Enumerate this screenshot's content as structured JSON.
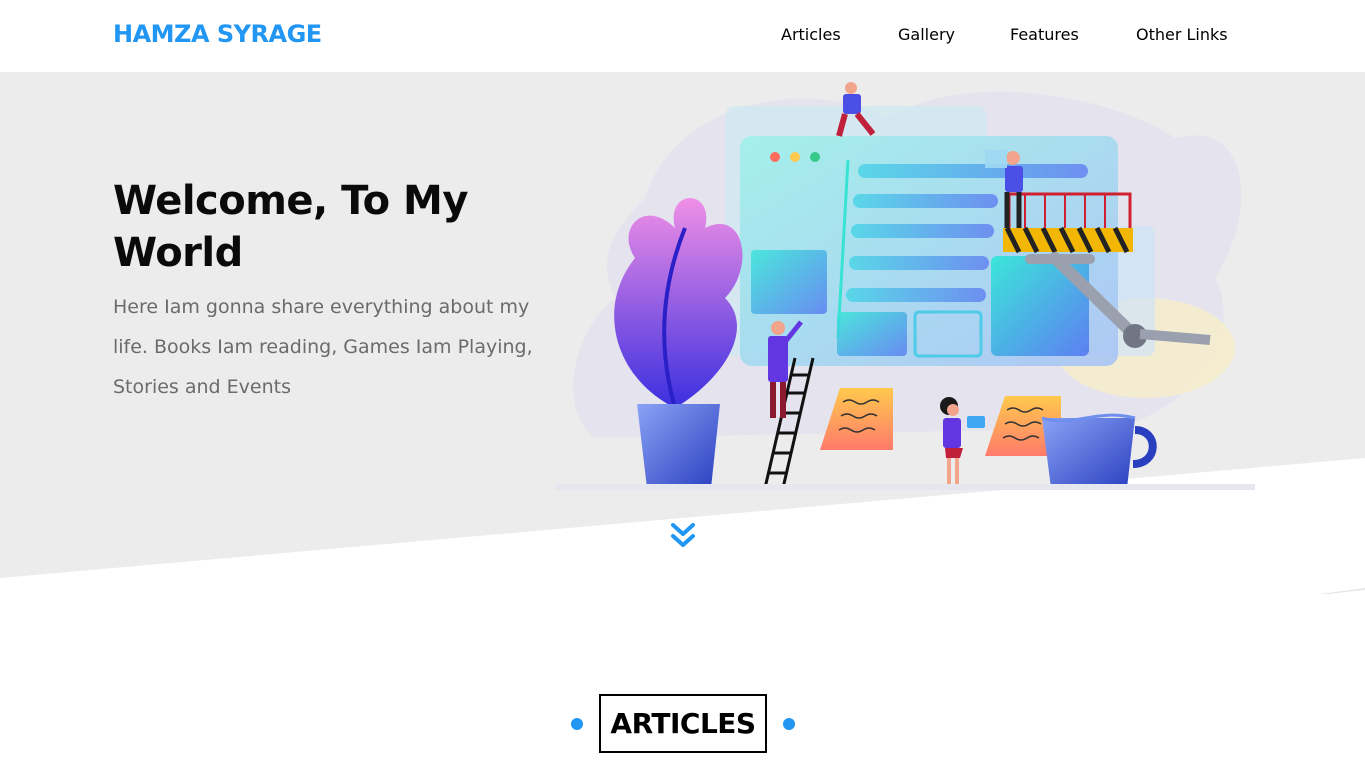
{
  "brand": {
    "name": "HAMZA SYRAGE",
    "accent": "#2196f3"
  },
  "nav": {
    "items": [
      {
        "label": "Articles"
      },
      {
        "label": "Gallery"
      },
      {
        "label": "Features"
      },
      {
        "label": "Other Links"
      }
    ]
  },
  "hero": {
    "title": "Welcome, To My World",
    "text": "Here Iam gonna share everything about my life. Books Iam reading, Games Iam Playing, Stories and Events",
    "background": "#ececec"
  },
  "scroll": {
    "icon": "double-chevron-down-icon"
  },
  "section": {
    "title": "ARTICLES"
  }
}
